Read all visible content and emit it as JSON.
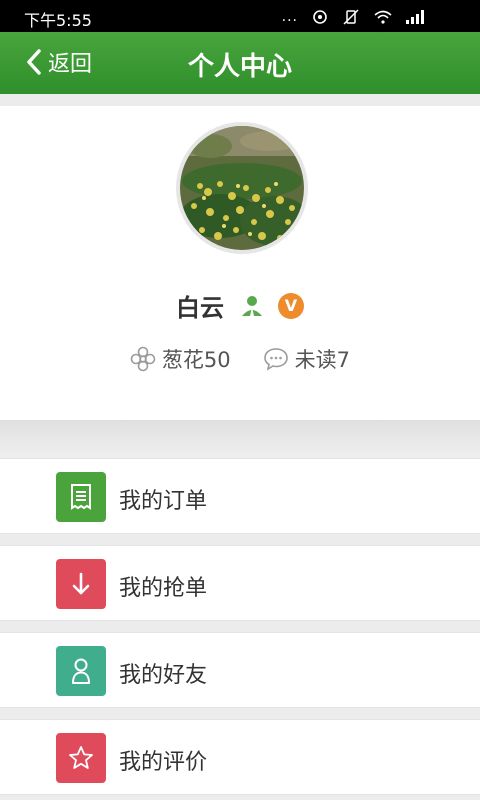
{
  "status": {
    "time": "下午5:55",
    "dots": "..."
  },
  "header": {
    "back_label": "返回",
    "title": "个人中心"
  },
  "profile": {
    "name": "白云",
    "points_label": "葱花50",
    "unread_label": "未读7",
    "vip_badge": "V"
  },
  "menu": [
    {
      "label": "我的订单",
      "icon": "receipt-icon",
      "color": "#4aa43b"
    },
    {
      "label": "我的抢单",
      "icon": "arrow-down-icon",
      "color": "#e04b5c"
    },
    {
      "label": "我的好友",
      "icon": "person-outline-icon",
      "color": "#40ad8c"
    },
    {
      "label": "我的评价",
      "icon": "star-outline-icon",
      "color": "#e04b5c"
    }
  ],
  "colors": {
    "appbar": "#3a9a32",
    "vip": "#ee8b2d"
  }
}
